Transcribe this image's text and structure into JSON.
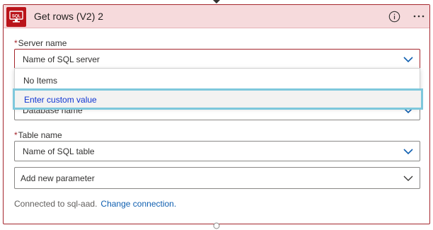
{
  "header": {
    "title": "Get rows (V2) 2",
    "icon_text": "SQL",
    "icon": "sql-server-icon",
    "accent_color": "#ba141a"
  },
  "fields": {
    "server": {
      "label": "Server name",
      "required_mark": "*",
      "placeholder": "Name of SQL server"
    },
    "database": {
      "placeholder": "Database name"
    },
    "table": {
      "label": "Table name",
      "required_mark": "*",
      "placeholder": "Name of SQL table"
    },
    "add_parameter": {
      "placeholder": "Add new parameter"
    }
  },
  "dropdown": {
    "no_items": "No Items",
    "custom_value": "Enter custom value"
  },
  "footer": {
    "connected_text": "Connected to sql-aad.",
    "change_link": "Change connection."
  }
}
